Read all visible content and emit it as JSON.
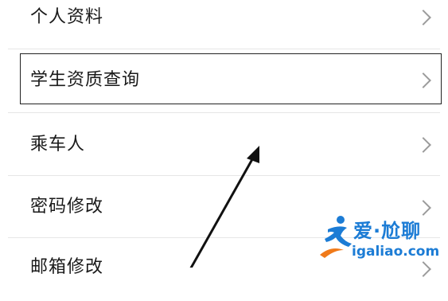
{
  "menu": {
    "items": [
      {
        "label": "个人资料",
        "chevron_icon": "chevron-right-icon"
      },
      {
        "label": "学生资质查询",
        "chevron_icon": "chevron-right-icon"
      },
      {
        "label": "乘车人",
        "chevron_icon": "chevron-right-icon"
      },
      {
        "label": "密码修改",
        "chevron_icon": "chevron-right-icon"
      },
      {
        "label": "邮箱修改",
        "chevron_icon": "chevron-right-icon"
      }
    ],
    "highlighted_item": "学生资质查询"
  },
  "annotation": {
    "arrow_icon": "pointer-arrow-icon"
  },
  "watermark": {
    "logo_icon": "runner-logo-icon",
    "title": "爱·尬聊",
    "url": "igaliao.com",
    "color": "#1c7cd5",
    "accent_color": "#f07a1a"
  }
}
